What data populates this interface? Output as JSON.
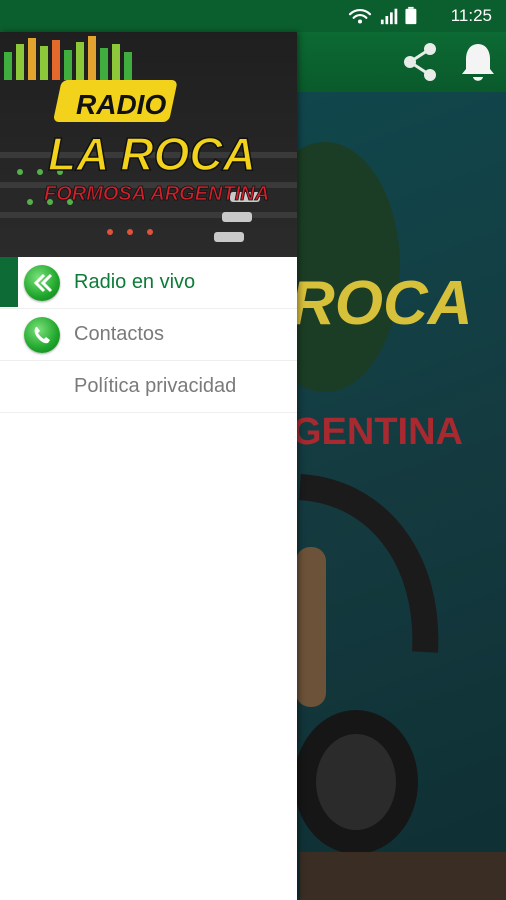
{
  "status_bar": {
    "time": "11:25",
    "icons": [
      "wifi-icon",
      "signal-icon",
      "battery-icon"
    ]
  },
  "app_bar": {
    "actions": [
      "share-icon",
      "bell-icon"
    ],
    "color": "#0b5f2e"
  },
  "drawer": {
    "header": {
      "line1": "RADIO",
      "line2": "LA ROCA",
      "line3": "FORMOSA ARGENTINA"
    },
    "items": [
      {
        "label": "Radio en vivo",
        "icon": "back-arrows-icon",
        "active": true
      },
      {
        "label": "Contactos",
        "icon": "phone-icon",
        "active": false
      },
      {
        "label": "Política privacidad",
        "icon": "",
        "active": false
      }
    ]
  },
  "background": {
    "logo_text": "ROCA",
    "subtitle_text": "GENTINA"
  },
  "colors": {
    "brand_green": "#0b5f2e",
    "active_text": "#0d7c38",
    "inactive_text": "#7a7a7a",
    "accent_red": "#c8102e"
  }
}
